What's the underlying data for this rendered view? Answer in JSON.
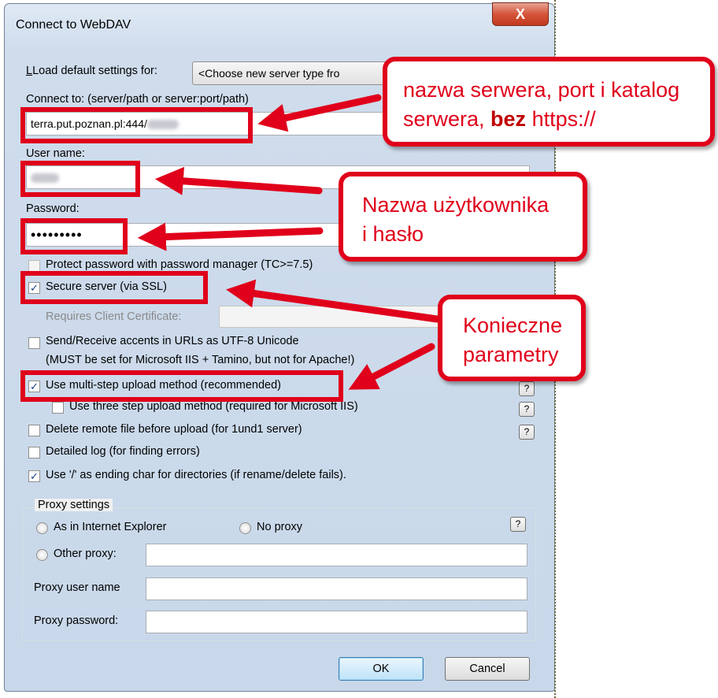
{
  "window": {
    "title": "Connect to WebDAV",
    "close_glyph": "X"
  },
  "form": {
    "load_defaults_label": "Load default settings for:",
    "load_defaults_value": "<Choose new server type fro",
    "connect_to_label": "Connect to: (server/path or server:port/path)",
    "connect_to_value": "terra.put.poznan.pl:444/",
    "user_name_label": "User name:",
    "password_label": "Password:",
    "password_value": "•••••••••",
    "protect_password_label": "Protect password with password manager (TC>=7.5)",
    "secure_server_label": "Secure server (via SSL)",
    "requires_cert_label": "Requires Client Certificate:",
    "send_receive_label": "Send/Receive accents in URLs as UTF-8 Unicode",
    "send_receive_note": "(MUST be set for Microsoft IIS + Tamino, but not for Apache!)",
    "multi_step_label": "Use multi-step upload method (recommended)",
    "three_step_label": "Use three step upload method (required for Microsoft IIS)",
    "delete_remote_label": "Delete remote file before upload (for 1und1 server)",
    "detailed_log_label": "Detailed log (for finding errors)",
    "use_slash_label": "Use '/' as ending char for directories (if rename/delete fails).",
    "help_glyph": "?"
  },
  "proxy": {
    "group_title": "Proxy settings",
    "as_in_ie_label": "As in Internet Explorer",
    "no_proxy_label": "No proxy",
    "other_proxy_label": "Other proxy:",
    "proxy_user_label": "Proxy user name",
    "proxy_password_label": "Proxy password:"
  },
  "buttons": {
    "ok": "OK",
    "cancel": "Cancel"
  },
  "annotations": {
    "callout_server_line1": "nazwa serwera, port i katalog",
    "callout_server_line2_pre": "serwera, ",
    "callout_server_line2_bold": "bez",
    "callout_server_line2_post": " https://",
    "callout_user_line1": "Nazwa użytkownika",
    "callout_user_line2": "i hasło",
    "callout_params_line1": "Konieczne",
    "callout_params_line2": "parametry",
    "color": "#e0001b"
  },
  "state": {
    "protect_password_checked": false,
    "secure_server_checked": true,
    "send_receive_checked": false,
    "multi_step_checked": true,
    "three_step_checked": false,
    "delete_remote_checked": false,
    "detailed_log_checked": false,
    "use_slash_checked": true
  }
}
